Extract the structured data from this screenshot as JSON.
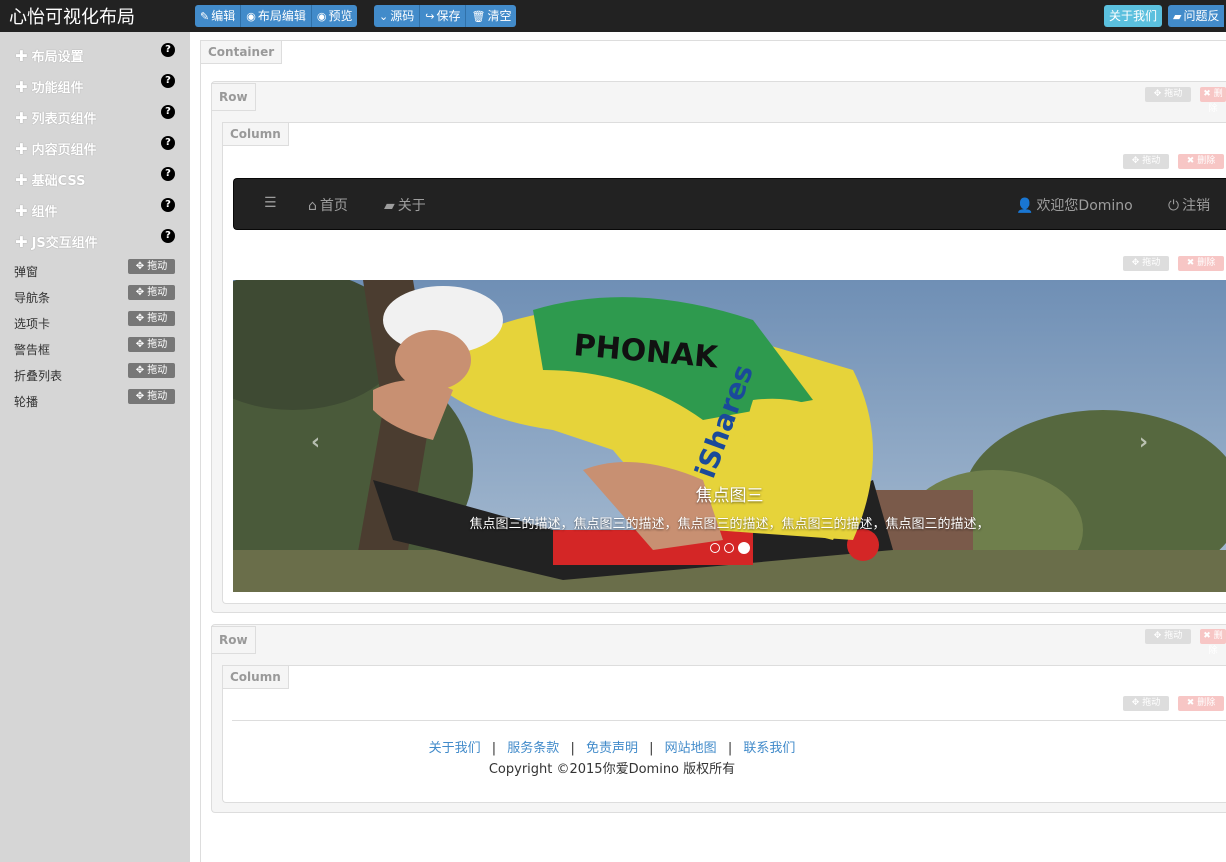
{
  "app": {
    "title": "心怡可视化布局"
  },
  "toolbar": {
    "edit": "编辑",
    "layout_edit": "布局编辑",
    "preview": "预览",
    "source": "源码",
    "save": "保存",
    "clear": "清空",
    "about": "关于我们",
    "feedback": "问题反"
  },
  "sidebar": {
    "categories": [
      "布局设置",
      "功能组件",
      "列表页组件",
      "内容页组件",
      "基础CSS",
      "组件",
      "JS交互组件"
    ],
    "components": [
      "弹窗",
      "导航条",
      "选项卡",
      "警告框",
      "折叠列表",
      "轮播"
    ],
    "drag_label": "拖动",
    "help": "?"
  },
  "canvas": {
    "container_label": "Container",
    "row_label": "Row",
    "column_label": "Column",
    "move_label": "拖动",
    "delete_label": "删除"
  },
  "navbar": {
    "home": "首页",
    "about": "关于",
    "welcome": "欢迎您Domino",
    "logout": "注销"
  },
  "carousel": {
    "caption_title": "焦点图三",
    "caption_desc": "焦点图三的描述，焦点图三的描述，焦点图三的描述，焦点图三的描述，焦点图三的描述，",
    "slides": 3,
    "active": 3
  },
  "footer": {
    "links": [
      "关于我们",
      "服务条款",
      "免责声明",
      "网站地图",
      "联系我们"
    ],
    "separator": "|",
    "copyright": "Copyright ©2015你爱Domino 版权所有"
  },
  "colors": {
    "primary": "#428bca",
    "info": "#5bc0de",
    "dark": "#222222",
    "sidebar": "#d6d6d6"
  }
}
